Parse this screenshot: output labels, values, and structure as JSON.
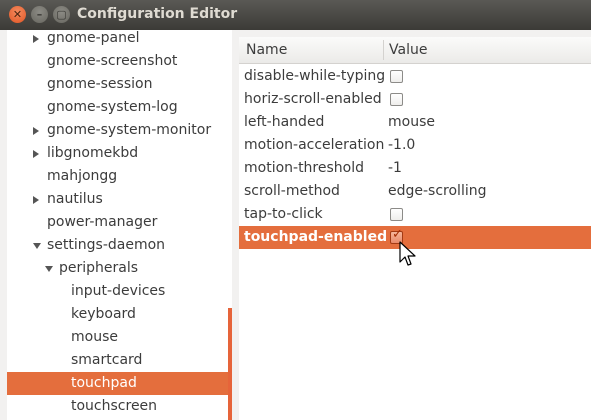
{
  "window": {
    "title": "Configuration Editor",
    "close_glyph": "✕",
    "min_glyph": "–",
    "max_glyph": "▢"
  },
  "tree": [
    {
      "label": "gnome-panel",
      "expander": "right",
      "level": 1,
      "selected": false
    },
    {
      "label": "gnome-screenshot",
      "expander": "none",
      "level": 1,
      "selected": false
    },
    {
      "label": "gnome-session",
      "expander": "none",
      "level": 1,
      "selected": false
    },
    {
      "label": "gnome-system-log",
      "expander": "none",
      "level": 1,
      "selected": false
    },
    {
      "label": "gnome-system-monitor",
      "expander": "right",
      "level": 1,
      "selected": false
    },
    {
      "label": "libgnomekbd",
      "expander": "right",
      "level": 1,
      "selected": false
    },
    {
      "label": "mahjongg",
      "expander": "none",
      "level": 1,
      "selected": false
    },
    {
      "label": "nautilus",
      "expander": "right",
      "level": 1,
      "selected": false
    },
    {
      "label": "power-manager",
      "expander": "none",
      "level": 1,
      "selected": false
    },
    {
      "label": "settings-daemon",
      "expander": "down",
      "level": 1,
      "selected": false
    },
    {
      "label": "peripherals",
      "expander": "down",
      "level": 2,
      "selected": false
    },
    {
      "label": "input-devices",
      "expander": "none",
      "level": 3,
      "selected": false
    },
    {
      "label": "keyboard",
      "expander": "none",
      "level": 3,
      "selected": false
    },
    {
      "label": "mouse",
      "expander": "none",
      "level": 3,
      "selected": false
    },
    {
      "label": "smartcard",
      "expander": "none",
      "level": 3,
      "selected": false
    },
    {
      "label": "touchpad",
      "expander": "none",
      "level": 3,
      "selected": true
    },
    {
      "label": "touchscreen",
      "expander": "none",
      "level": 3,
      "selected": false
    }
  ],
  "table": {
    "columns": {
      "name": "Name",
      "value": "Value"
    },
    "rows": [
      {
        "name": "disable-while-typing",
        "type": "bool",
        "checked": false,
        "selected": false,
        "value": ""
      },
      {
        "name": "horiz-scroll-enabled",
        "type": "bool",
        "checked": false,
        "selected": false,
        "value": ""
      },
      {
        "name": "left-handed",
        "type": "text",
        "value": "mouse",
        "selected": false
      },
      {
        "name": "motion-acceleration",
        "type": "text",
        "value": "-1.0",
        "selected": false
      },
      {
        "name": "motion-threshold",
        "type": "text",
        "value": "-1",
        "selected": false
      },
      {
        "name": "scroll-method",
        "type": "text",
        "value": "edge-scrolling",
        "selected": false
      },
      {
        "name": "tap-to-click",
        "type": "bool",
        "checked": false,
        "selected": false,
        "value": ""
      },
      {
        "name": "touchpad-enabled",
        "type": "bool",
        "checked": true,
        "selected": true,
        "value": ""
      }
    ]
  },
  "colors": {
    "selection": "#e46e3d",
    "titlebar": "#3c3b37",
    "close_button": "#e05524"
  },
  "icons": {
    "checkmark": "✓",
    "cursor": "arrow-pointer-icon"
  }
}
